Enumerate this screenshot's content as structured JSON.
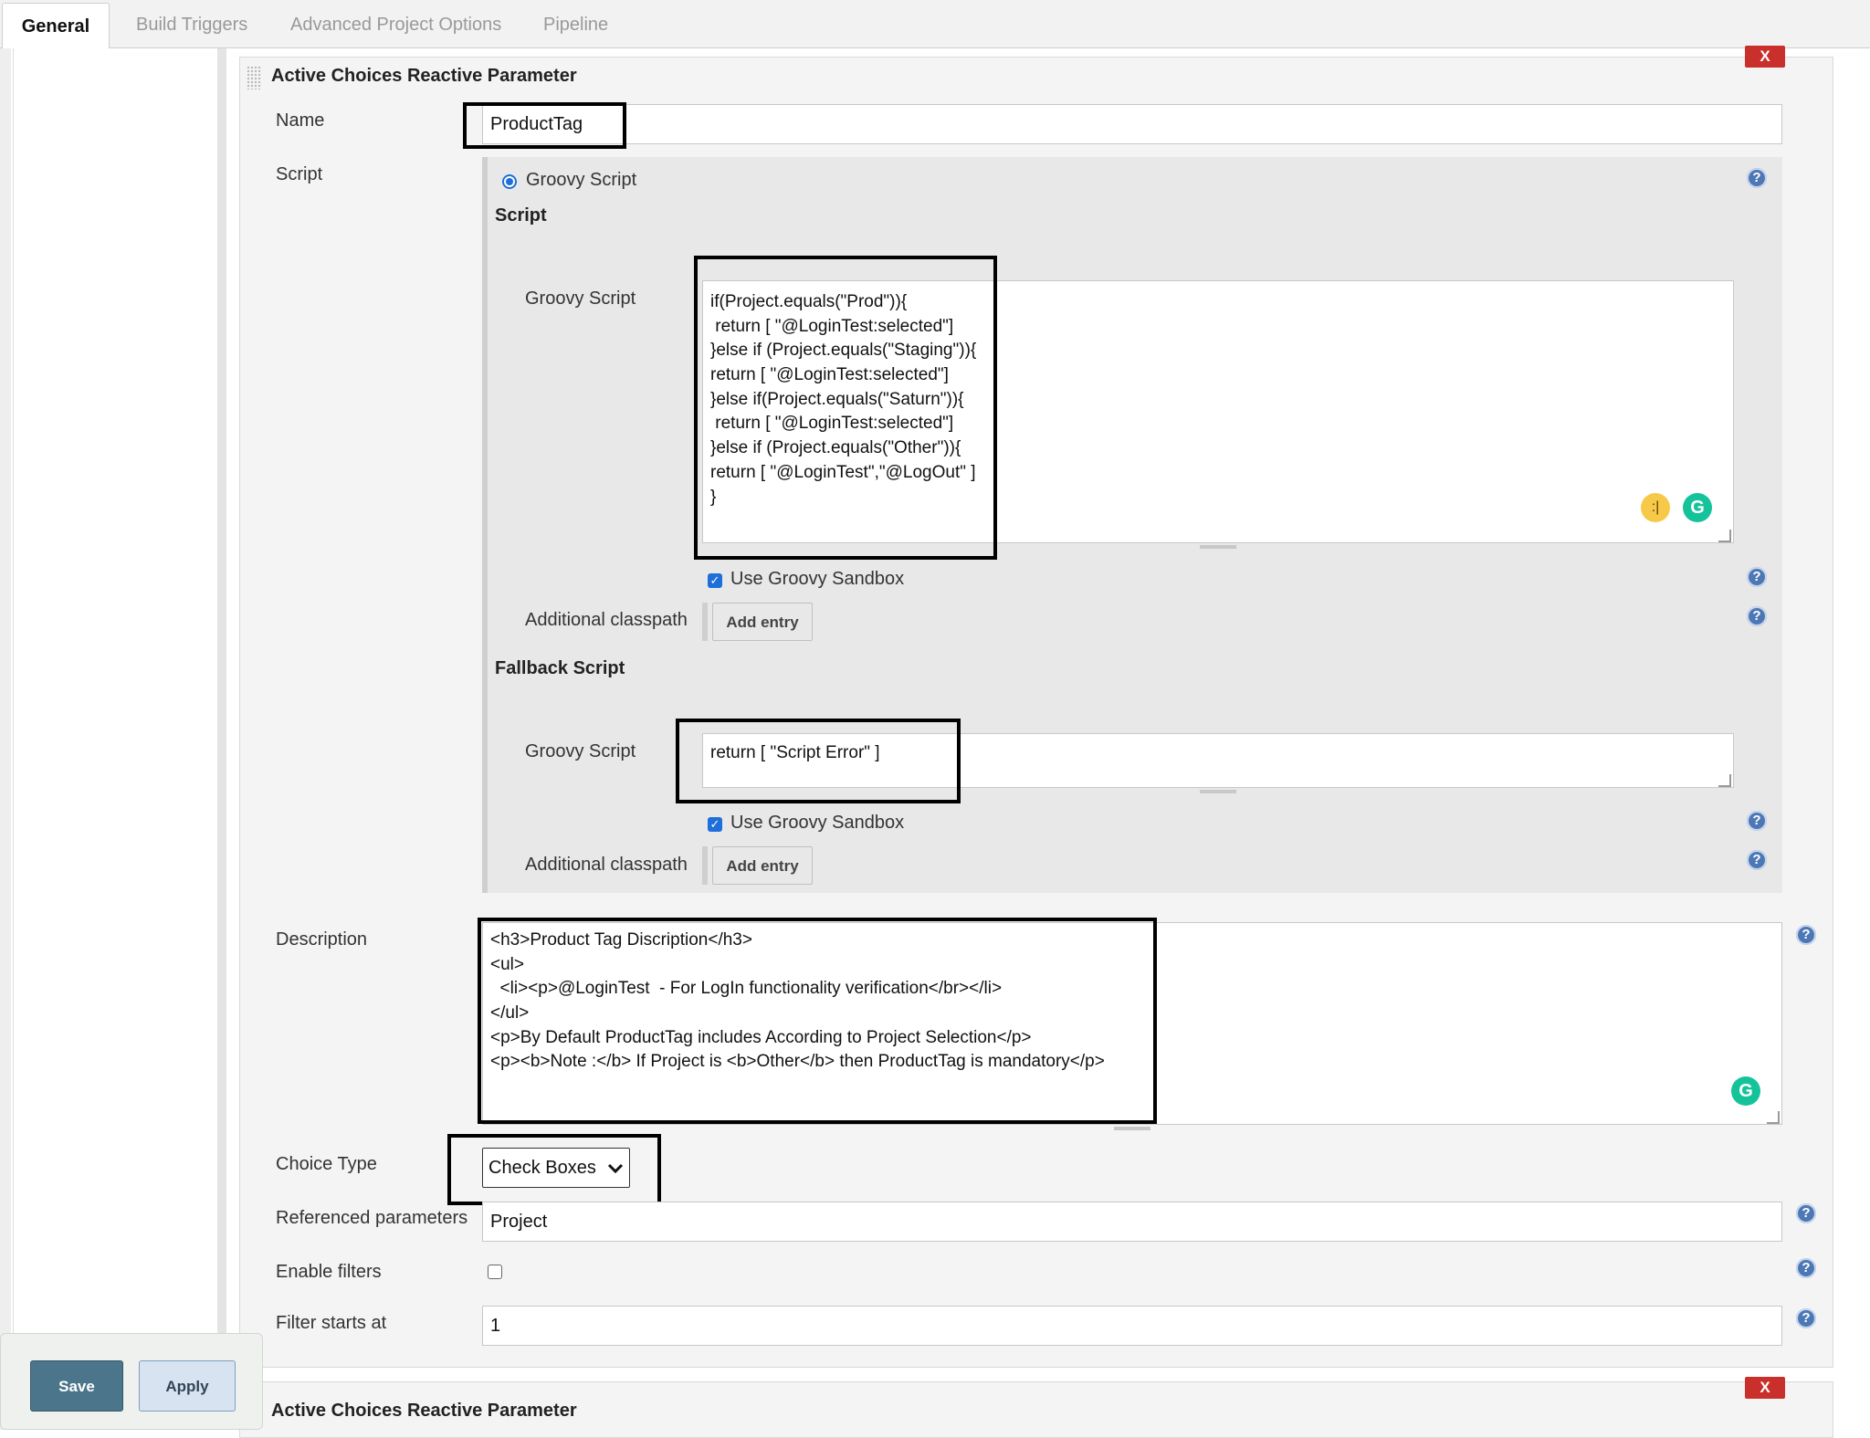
{
  "tabs": [
    {
      "label": "General",
      "active": true
    },
    {
      "label": "Build Triggers",
      "active": false
    },
    {
      "label": "Advanced Project Options",
      "active": false
    },
    {
      "label": "Pipeline",
      "active": false
    }
  ],
  "param": {
    "header": "Active Choices Reactive Parameter",
    "delete_label": "X",
    "name_label": "Name",
    "name_value": "ProductTag",
    "script_label": "Script",
    "groovy_radio_label": "Groovy Script",
    "script_section_title": "Script",
    "groovy_script_label": "Groovy Script",
    "script_lines": [
      "if(Project.equals(\"Prod\")){",
      " return [ \"@LoginTest:selected\"]",
      "}else if (Project.equals(\"Staging\")){",
      "return [ \"@LoginTest:selected\"]",
      "}else if(Project.equals(\"Saturn\")){",
      " return [ \"@LoginTest:selected\"]",
      "}else if (Project.equals(\"Other\")){",
      "return [ \"@LoginTest\",\"@LogOut\" ]",
      "}"
    ],
    "use_sandbox_label": "Use Groovy Sandbox",
    "additional_classpath_label": "Additional classpath",
    "add_entry_label": "Add entry",
    "fallback_title": "Fallback Script",
    "fallback_groovy_label": "Groovy Script",
    "fallback_script": "return [ \"Script Error\" ]",
    "fallback_sandbox_label": "Use Groovy Sandbox",
    "fallback_classpath_label": "Additional classpath",
    "fallback_add_entry_label": "Add entry",
    "description_label": "Description",
    "description_lines": [
      "<h3>Product Tag Discription</h3>",
      "<ul>",
      "  <li><p>@LoginTest  - For LogIn functionality verification</br></li>",
      "</ul>",
      "<p>By Default ProductTag includes According to Project Selection</p>",
      "<p><b>Note :</b> If Project is <b>Other</b> then ProductTag is mandatory</p>"
    ],
    "choice_type_label": "Choice Type",
    "choice_type_value": "Check Boxes",
    "referenced_params_label": "Referenced parameters",
    "referenced_params_value": "Project",
    "enable_filters_label": "Enable filters",
    "filter_starts_label": "Filter starts at",
    "filter_starts_value": "1"
  },
  "param2": {
    "header": "Active Choices Reactive Parameter",
    "delete_label": "X"
  },
  "footer": {
    "save_label": "Save",
    "apply_label": "Apply"
  },
  "help_glyph": "?",
  "grammarly_glyph": "G",
  "emoji_glyph": ":|"
}
